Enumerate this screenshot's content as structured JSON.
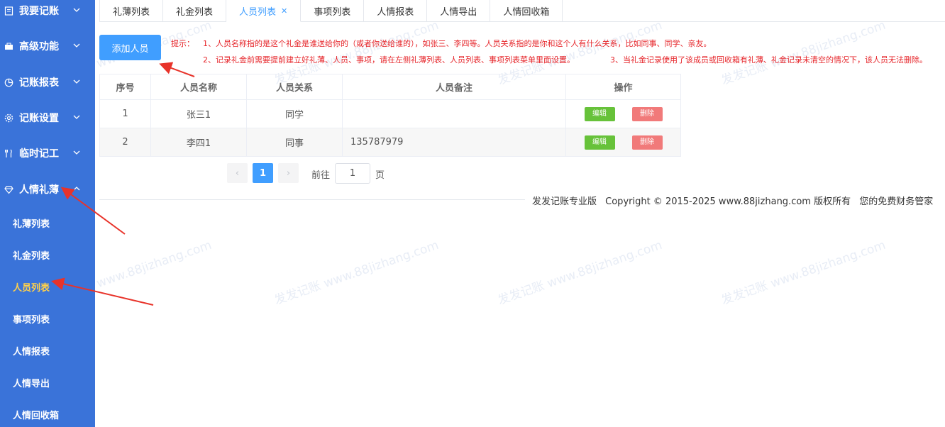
{
  "sidebar": {
    "menu": [
      {
        "label": "我要记账",
        "icon": "ledger-icon"
      },
      {
        "label": "高级功能",
        "icon": "briefcase-icon"
      },
      {
        "label": "记账报表",
        "icon": "pie-chart-icon"
      },
      {
        "label": "记账设置",
        "icon": "gear-icon"
      },
      {
        "label": "临时记工",
        "icon": "utensils-icon"
      },
      {
        "label": "人情礼薄",
        "icon": "gem-icon"
      }
    ],
    "submenu": [
      {
        "label": "礼薄列表"
      },
      {
        "label": "礼金列表"
      },
      {
        "label": "人员列表"
      },
      {
        "label": "事项列表"
      },
      {
        "label": "人情报表"
      },
      {
        "label": "人情导出"
      },
      {
        "label": "人情回收箱"
      }
    ]
  },
  "tabs": [
    "礼薄列表",
    "礼金列表",
    "人员列表",
    "事项列表",
    "人情报表",
    "人情导出",
    "人情回收箱"
  ],
  "toolbar": {
    "add_label": "添加人员",
    "tip_prefix": "提示：",
    "tip1": "1、人员名称指的是这个礼金是谁送给你的（或者你送给谁的），如张三、李四等。人员关系指的是你和这个人有什么关系，比如同事、同学、亲友。",
    "tip2": "2、记录礼金前需要提前建立好礼薄、人员、事项，请在左侧礼薄列表、人员列表、事项列表菜单里面设置。",
    "tip3": "3、当礼金记录使用了该成员或回收箱有礼薄、礼金记录未清空的情况下，该人员无法删除。"
  },
  "table": {
    "headers": [
      "序号",
      "人员名称",
      "人员关系",
      "人员备注",
      "操作"
    ],
    "rows": [
      {
        "no": "1",
        "name": "张三1",
        "relation": "同学",
        "note": ""
      },
      {
        "no": "2",
        "name": "李四1",
        "relation": "同事",
        "note": "135787979"
      }
    ],
    "edit_label": "编辑",
    "delete_label": "删除"
  },
  "pagination": {
    "prev": "‹",
    "current": "1",
    "next": "›",
    "goto_label": "前往",
    "goto_value": "1",
    "page_unit": "页"
  },
  "footer": {
    "brand": "发发记账专业版",
    "copyright": "Copyright © 2015-2025 www.88jizhang.com 版权所有",
    "slogan": "您的免费财务管家"
  },
  "watermark": "发发记账 www.88jizhang.com",
  "colors": {
    "sidebar": "#3a73d9",
    "active_sub": "#ffd04b",
    "primary": "#409eff",
    "edit": "#67c23a",
    "delete": "#f17a7a",
    "tip": "#e6252a",
    "arrow": "#e8332a"
  }
}
